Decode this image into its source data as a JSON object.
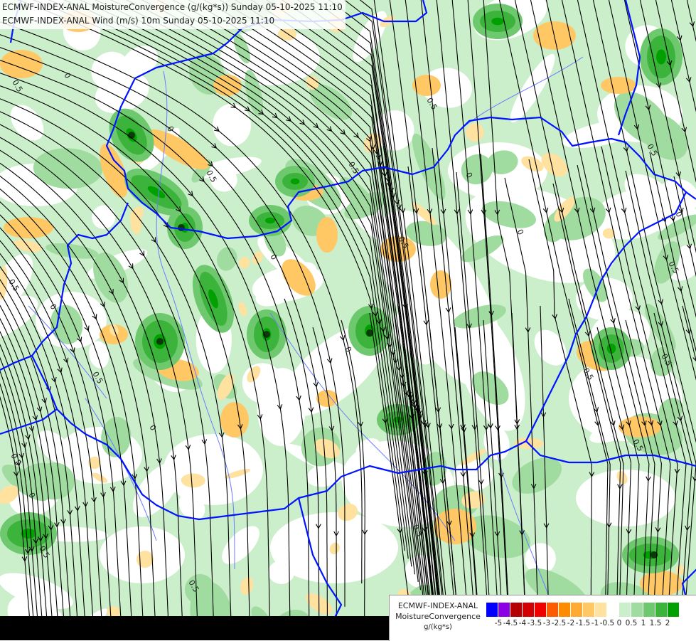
{
  "titles": {
    "line1": "ECMWF-INDEX-ANAL MoistureConvergence (g/(kg*s)) Sunday 05-10-2025 11:10",
    "line2": "ECMWF-INDEX-ANAL Wind (m/s) 10m Sunday 05-10-2025 11:10"
  },
  "contour_labels": [
    "0",
    "0.5"
  ],
  "legend": {
    "line1": "ECMWF-INDEX-ANAL",
    "line2": "MoistureConvergence",
    "unit": "g/(kg*s)",
    "colors": [
      "#0000ff",
      "#8c00e6",
      "#b40000",
      "#d20000",
      "#f00000",
      "#ff5a00",
      "#ff8c00",
      "#ffaa32",
      "#ffc864",
      "#ffe1a0",
      "#ffffff",
      "#cbeecb",
      "#a0dca0",
      "#6ec86e",
      "#3cb43c",
      "#00a000"
    ],
    "ticks": [
      "-5",
      "-4.5",
      "-4",
      "-3.5",
      "-3",
      "-2.5",
      "-2",
      "-1.5",
      "-1",
      "-0.5",
      "0",
      "0.5",
      "1",
      "1.5",
      "2"
    ]
  }
}
